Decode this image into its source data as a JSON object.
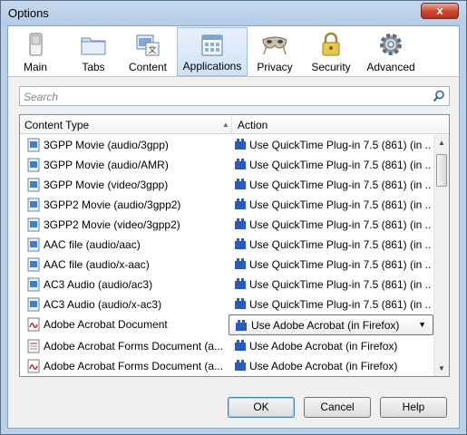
{
  "window": {
    "title": "Options",
    "close_label": "x"
  },
  "toolbar": {
    "items": [
      {
        "label": "Main",
        "icon": "main-switch-icon"
      },
      {
        "label": "Tabs",
        "icon": "tabs-folder-icon"
      },
      {
        "label": "Content",
        "icon": "content-picture-icon"
      },
      {
        "label": "Applications",
        "icon": "applications-window-icon",
        "selected": true
      },
      {
        "label": "Privacy",
        "icon": "privacy-mask-icon"
      },
      {
        "label": "Security",
        "icon": "security-lock-icon"
      },
      {
        "label": "Advanced",
        "icon": "advanced-gear-icon"
      }
    ]
  },
  "search": {
    "placeholder": "Search"
  },
  "list": {
    "columns": [
      "Content Type",
      "Action"
    ],
    "rows": [
      {
        "type": "3GPP Movie (audio/3gpp)",
        "action": "Use QuickTime Plug-in 7.5 (861) (in ...",
        "icon": "media-file-icon"
      },
      {
        "type": "3GPP Movie (audio/AMR)",
        "action": "Use QuickTime Plug-in 7.5 (861) (in ...",
        "icon": "media-file-icon"
      },
      {
        "type": "3GPP Movie (video/3gpp)",
        "action": "Use QuickTime Plug-in 7.5 (861) (in ...",
        "icon": "media-file-icon"
      },
      {
        "type": "3GPP2 Movie (audio/3gpp2)",
        "action": "Use QuickTime Plug-in 7.5 (861) (in ...",
        "icon": "media-file-icon"
      },
      {
        "type": "3GPP2 Movie (video/3gpp2)",
        "action": "Use QuickTime Plug-in 7.5 (861) (in ...",
        "icon": "media-file-icon"
      },
      {
        "type": "AAC file (audio/aac)",
        "action": "Use QuickTime Plug-in 7.5 (861) (in ...",
        "icon": "media-file-icon"
      },
      {
        "type": "AAC file (audio/x-aac)",
        "action": "Use QuickTime Plug-in 7.5 (861) (in ...",
        "icon": "media-file-icon"
      },
      {
        "type": "AC3 Audio (audio/ac3)",
        "action": "Use QuickTime Plug-in 7.5 (861) (in ...",
        "icon": "media-file-icon"
      },
      {
        "type": "AC3 Audio (audio/x-ac3)",
        "action": "Use QuickTime Plug-in 7.5 (861) (in ...",
        "icon": "media-file-icon"
      },
      {
        "type": "Adobe Acrobat Document",
        "action": "Use Adobe Acrobat (in Firefox)",
        "icon": "pdf-file-icon",
        "selected": true
      },
      {
        "type": "Adobe Acrobat Forms Document (a...",
        "action": "Use Adobe Acrobat (in Firefox)",
        "icon": "form-file-icon"
      },
      {
        "type": "Adobe Acrobat Forms Document (a...",
        "action": "Use Adobe Acrobat (in Firefox)",
        "icon": "pdf-file-icon"
      }
    ]
  },
  "buttons": {
    "ok": "OK",
    "cancel": "Cancel",
    "help": "Help"
  },
  "colors": {
    "plugin_blue": "#2a5bb8",
    "pdf_red": "#c0201c",
    "selection_blue": "#cfe2f7"
  }
}
